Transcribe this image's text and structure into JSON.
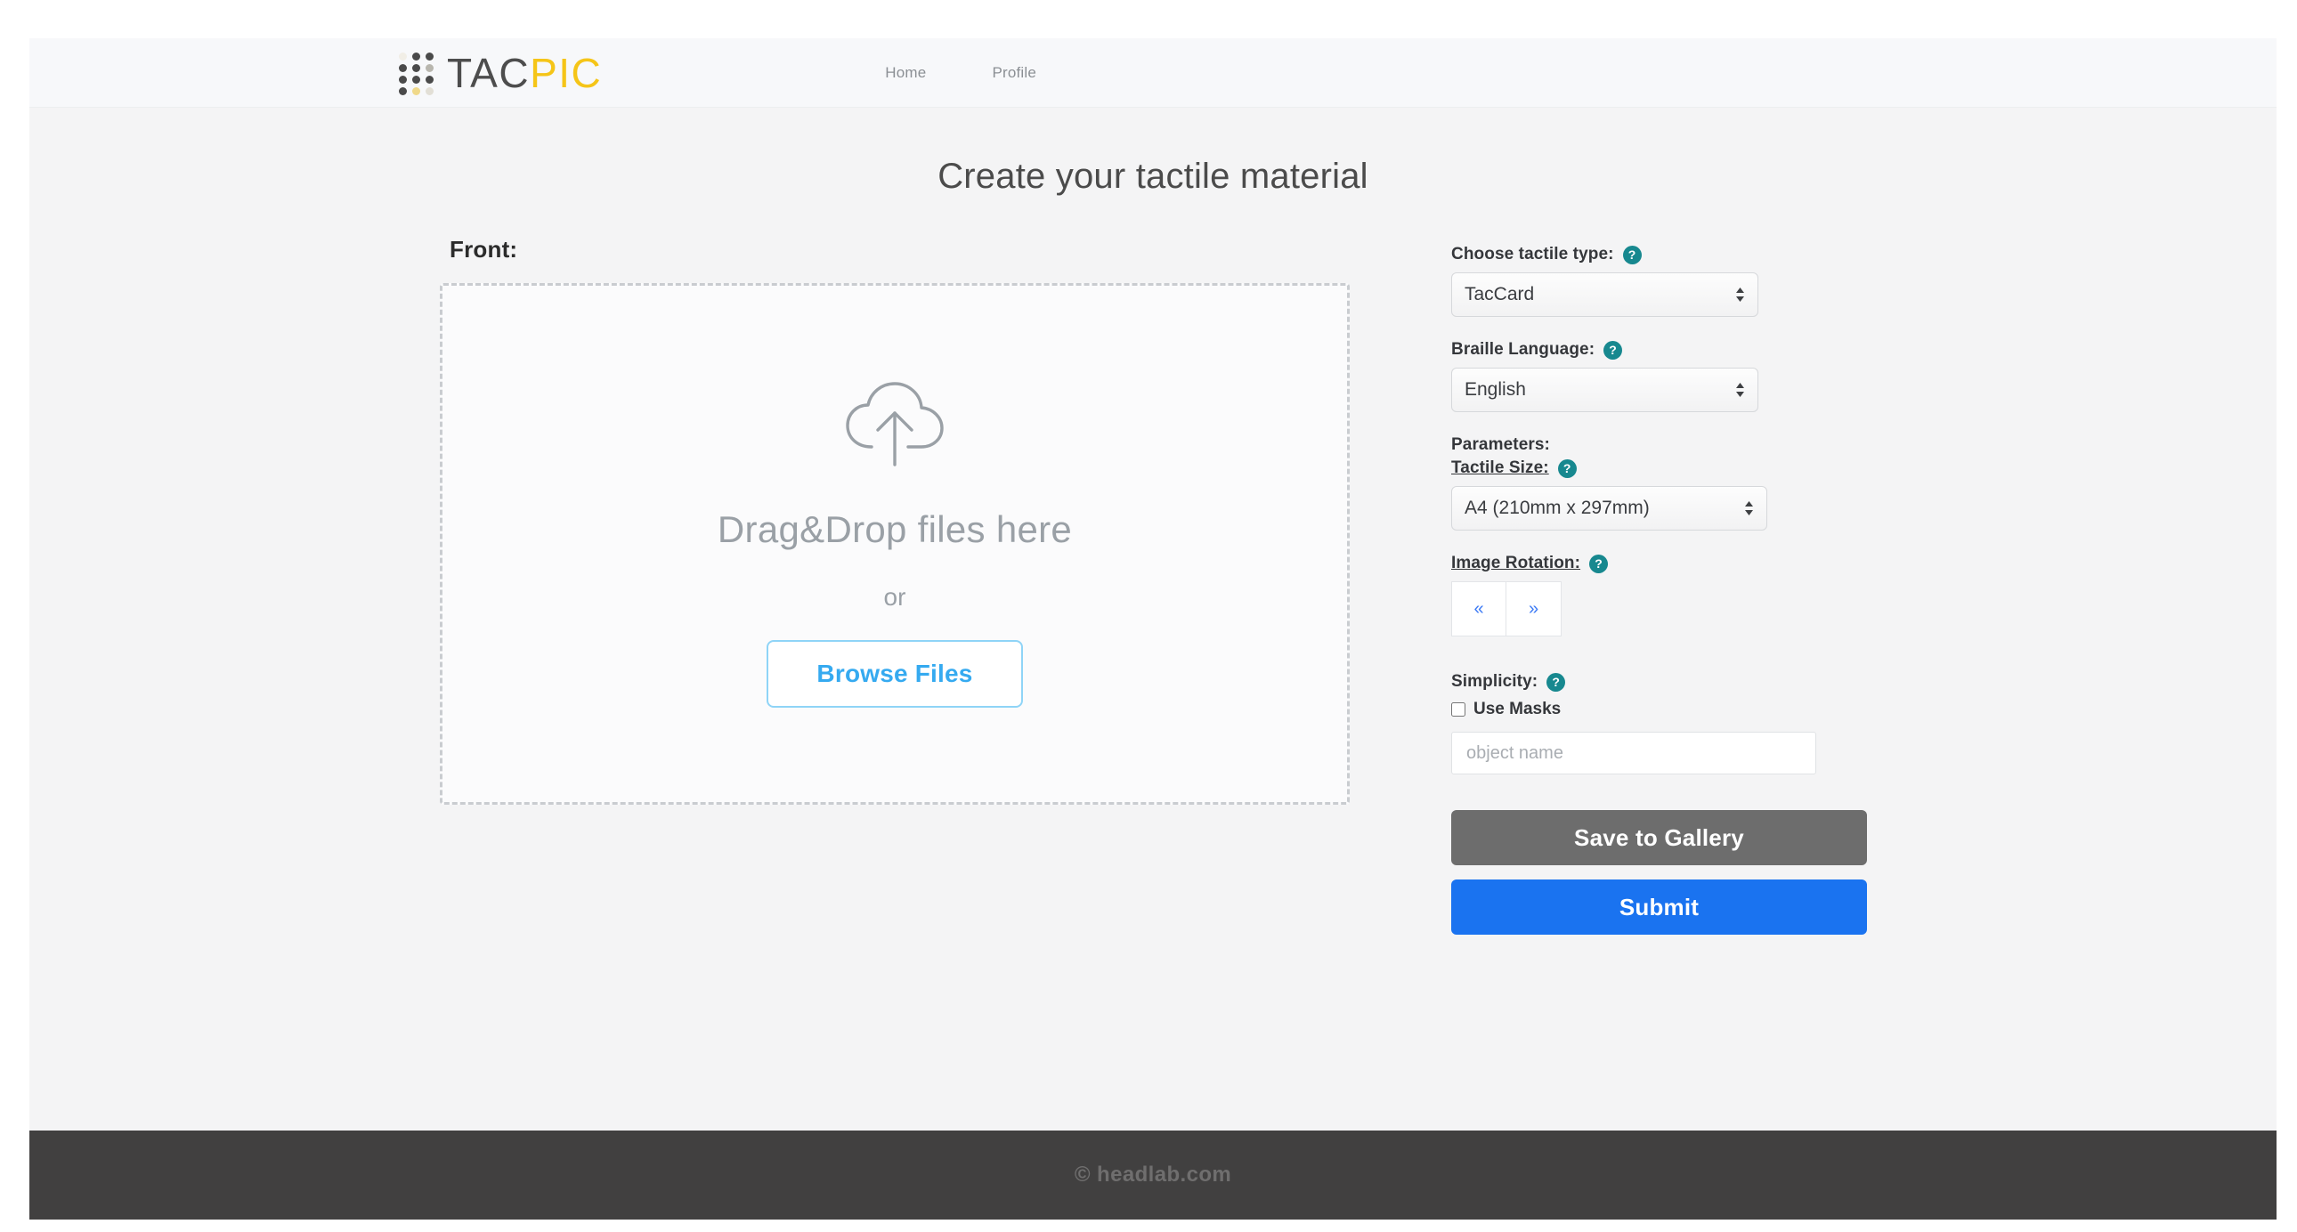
{
  "header": {
    "brand": {
      "part1": "TAC",
      "part2": "PIC"
    },
    "nav": [
      {
        "label": "Home"
      },
      {
        "label": "Profile"
      }
    ]
  },
  "main": {
    "title": "Create your tactile material",
    "upload": {
      "side_label": "Front:",
      "icon": "cloud-upload-icon",
      "drop_text": "Drag&Drop files here",
      "or_text": "or",
      "browse_label": "Browse Files"
    },
    "settings": {
      "tactile_type": {
        "label": "Choose tactile type:",
        "help": "?",
        "value": "TacCard",
        "options": [
          "TacCard"
        ]
      },
      "braille_language": {
        "label": "Braille Language:",
        "help": "?",
        "value": "English",
        "options": [
          "English"
        ]
      },
      "parameters_heading": "Parameters:",
      "tactile_size": {
        "label": "Tactile Size:",
        "help": "?",
        "value": "A4 (210mm x 297mm)",
        "options": [
          "A4 (210mm x 297mm)"
        ]
      },
      "image_rotation": {
        "label": "Image Rotation:",
        "help": "?",
        "rotate_left": "«",
        "rotate_right": "»"
      },
      "simplicity": {
        "label": "Simplicity:",
        "help": "?",
        "use_masks_label": "Use Masks",
        "use_masks_checked": false,
        "object_name_placeholder": "object name",
        "object_name_value": ""
      },
      "save_label": "Save to Gallery",
      "submit_label": "Submit"
    }
  },
  "footer": {
    "copyright": "© headlab.com"
  },
  "colors": {
    "brand_accent": "#f5c518",
    "brand_dark": "#4d4d4d",
    "submit_blue": "#1a73f0",
    "save_gray": "#6d6d6d",
    "help_teal": "#17888f",
    "browse_blue": "#35aaf0",
    "footer_bg": "#414040"
  }
}
